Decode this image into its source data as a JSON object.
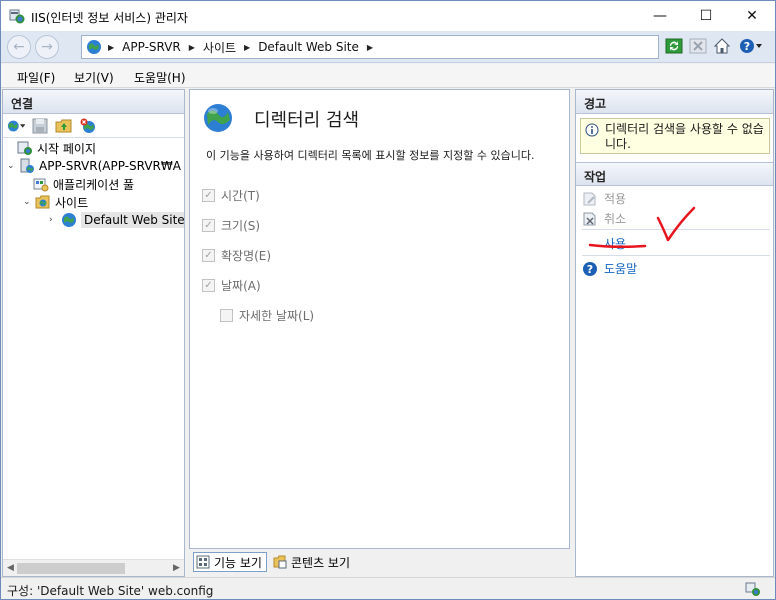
{
  "window": {
    "title": "IIS(인터넷 정보 서비스) 관리자",
    "minimize_glyph": "—",
    "maximize_glyph": "☐",
    "close_glyph": "✕"
  },
  "address_bar": {
    "back_glyph": "←",
    "forward_glyph": "→",
    "crumbs": [
      "APP-SRVR",
      "사이트",
      "Default Web Site"
    ],
    "separator_glyph": "▶",
    "help_glyph": "?"
  },
  "menu": {
    "items": [
      "파일(F)",
      "보기(V)",
      "도움말(H)"
    ]
  },
  "connections": {
    "header": "연결",
    "tree": {
      "start_page": "시작 페이지",
      "server": "APP-SRVR(APP-SRVR₩A",
      "app_pools": "애플리케이션 풀",
      "sites": "사이트",
      "default_site": "Default Web Site"
    },
    "twisty_open": "⌄",
    "twisty_closed": "›"
  },
  "feature": {
    "title": "디렉터리 검색",
    "description": "이 기능을 사용하여 디렉터리 목록에 표시할 정보를 지정할 수 있습니다.",
    "options": [
      {
        "label": "시간(T)",
        "checked": true
      },
      {
        "label": "크기(S)",
        "checked": true
      },
      {
        "label": "확장명(E)",
        "checked": true
      },
      {
        "label": "날짜(A)",
        "checked": true
      }
    ],
    "suboption": {
      "label": "자세한 날짜(L)",
      "checked": false
    },
    "check_glyph": "✓"
  },
  "view_tabs": {
    "features": "기능 보기",
    "content": "콘텐츠 보기"
  },
  "alerts": {
    "header": "경고",
    "message": "디렉터리 검색을 사용할 수 없습니다."
  },
  "actions": {
    "header": "작업",
    "apply": "적용",
    "cancel": "취소",
    "enable": "사용",
    "help": "도움말"
  },
  "status_bar": {
    "text": "구성: 'Default Web Site' web.config"
  },
  "colors": {
    "annotation_red": "#e8141e",
    "link_blue": "#1565c0",
    "alert_bg": "#ffffe1"
  }
}
